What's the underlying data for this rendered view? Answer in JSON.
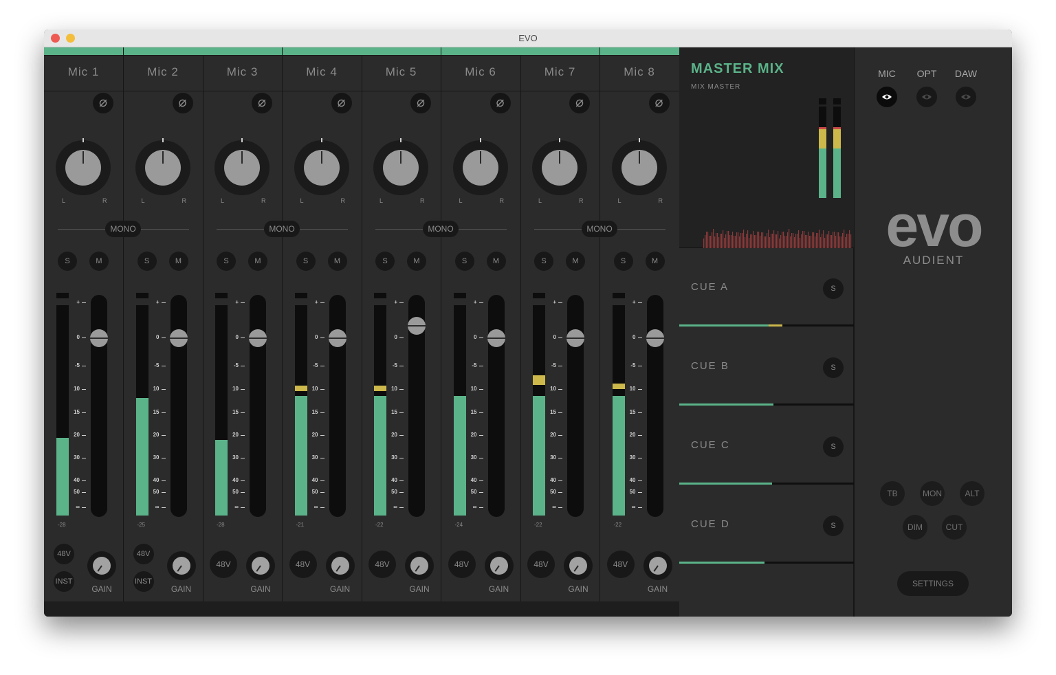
{
  "window": {
    "title": "EVO"
  },
  "channels": [
    {
      "name": "Mic 1",
      "peak": "-28",
      "level": 0.37,
      "peak_hold": null,
      "fader_db": "0",
      "btn48v": "48V",
      "inst": "INST",
      "gain": "GAIN"
    },
    {
      "name": "Mic 2",
      "peak": "-25",
      "level": 0.56,
      "peak_hold": null,
      "fader_db": "0",
      "btn48v": "48V",
      "inst": "INST",
      "gain": "GAIN"
    },
    {
      "name": "Mic 3",
      "peak": "-28",
      "level": 0.36,
      "peak_hold": null,
      "fader_db": "0",
      "btn48v": "48V",
      "inst": null,
      "gain": "GAIN"
    },
    {
      "name": "Mic 4",
      "peak": "-21",
      "level": 0.57,
      "peak_hold": 0.59,
      "fader_db": "0",
      "btn48v": "48V",
      "inst": null,
      "gain": "GAIN"
    },
    {
      "name": "Mic 5",
      "peak": "-22",
      "level": 0.57,
      "peak_hold": 0.59,
      "fader_db": "+",
      "btn48v": "48V",
      "inst": null,
      "gain": "GAIN"
    },
    {
      "name": "Mic 6",
      "peak": "-24",
      "level": 0.57,
      "peak_hold": null,
      "fader_db": "0",
      "btn48v": "48V",
      "inst": null,
      "gain": "GAIN"
    },
    {
      "name": "Mic 7",
      "peak": "-22",
      "level": 0.57,
      "peak_hold": 0.62,
      "fader_db": "0",
      "btn48v": "48V",
      "inst": null,
      "gain": "GAIN"
    },
    {
      "name": "Mic 8",
      "peak": "-22",
      "level": 0.57,
      "peak_hold": 0.6,
      "fader_db": "0",
      "btn48v": "48V",
      "inst": null,
      "gain": "GAIN"
    }
  ],
  "channel_labels": {
    "pan_left": "L",
    "pan_right": "R",
    "mono": "MONO",
    "solo": "S",
    "mute": "M",
    "phase_icon": "⌀",
    "scale": [
      "+",
      "0",
      "-5",
      "10",
      "15",
      "20",
      "30",
      "40",
      "50",
      "∞"
    ]
  },
  "master": {
    "title": "MASTER MIX",
    "subtitle": "MIX MASTER",
    "meter_left": 0.55,
    "meter_right": 0.55
  },
  "cues": [
    {
      "label": "CUE A",
      "solo": "S",
      "level": 0.59,
      "warn": 0.08
    },
    {
      "label": "CUE B",
      "solo": "S",
      "level": 0.54,
      "warn": 0
    },
    {
      "label": "CUE C",
      "solo": "S",
      "level": 0.53,
      "warn": 0
    },
    {
      "label": "CUE D",
      "solo": "S",
      "level": 0.49,
      "warn": 0
    }
  ],
  "sources": [
    {
      "label": "MIC",
      "icon": "eye-icon",
      "active": true
    },
    {
      "label": "OPT",
      "icon": "eye-icon",
      "active": false
    },
    {
      "label": "DAW",
      "icon": "eye-icon",
      "active": false
    }
  ],
  "logo": {
    "text": "evo",
    "sub": "AUDIENT"
  },
  "monitor_buttons": {
    "tb": "TB",
    "mon": "MON",
    "alt": "ALT",
    "dim": "DIM",
    "cut": "CUT"
  },
  "settings_label": "SETTINGS",
  "colors": {
    "accent": "#5bb389",
    "peak": "#cdb94b",
    "clip": "#c84848",
    "bg": "#2b2b2b"
  }
}
